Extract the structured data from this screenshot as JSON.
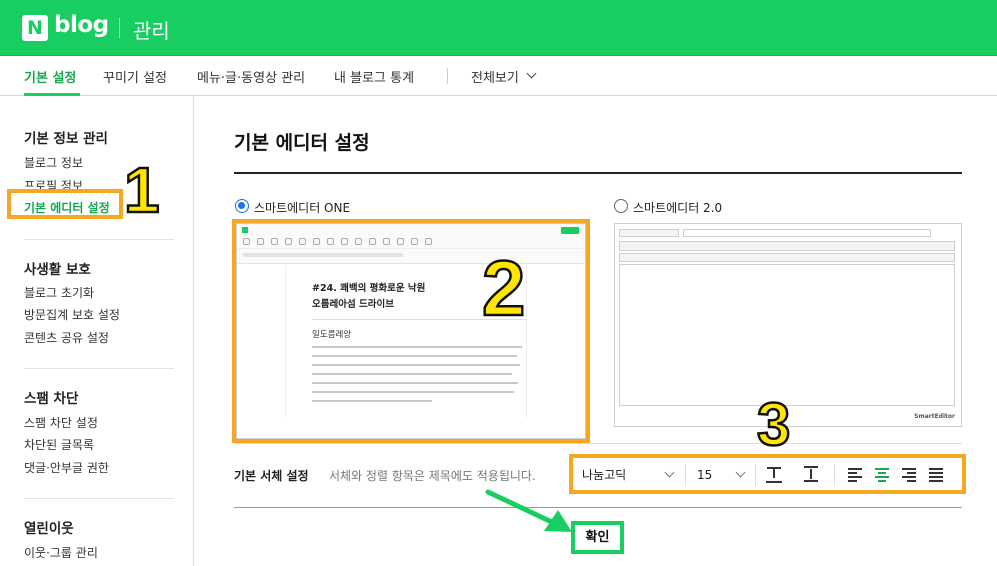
{
  "header": {
    "logo_letter": "N",
    "logo_text": "blog",
    "admin_label": "관리",
    "accent_color": "#19ce60"
  },
  "tabs": [
    {
      "label": "기본 설정",
      "active": true
    },
    {
      "label": "꾸미기 설정",
      "active": false
    },
    {
      "label": "메뉴·글·동영상 관리",
      "active": false
    },
    {
      "label": "내 블로그 통계",
      "active": false
    },
    {
      "label": "전체보기",
      "active": false
    }
  ],
  "sidebar": {
    "sections": [
      {
        "title": "기본 정보 관리",
        "items": [
          "블로그 정보",
          "프로필 정보",
          "기본 에디터 설정"
        ]
      },
      {
        "title": "사생활 보호",
        "items": [
          "블로그 초기화",
          "방문집계 보호 설정",
          "콘텐츠 공유 설정"
        ]
      },
      {
        "title": "스팸 차단",
        "items": [
          "스팸 차단 설정",
          "차단된 글목록",
          "댓글·안부글 권한"
        ]
      },
      {
        "title": "열린이웃",
        "items": [
          "이웃·그룹 관리"
        ]
      }
    ],
    "active_item": "기본 에디터 설정"
  },
  "main": {
    "title": "기본 에디터 설정",
    "editor_one_label": "스마트에디터 ONE",
    "editor_two_label": "스마트에디터 2.0",
    "selected_editor": "스마트에디터 ONE",
    "preview_one": {
      "title_line1": "#24. 쾌백의 평화로운 낙원",
      "title_line2": "오름레아섬 드라이브",
      "subtitle": "일도름레앙"
    },
    "preview_two": {
      "footer_logo": "SmartEditor"
    },
    "font_setting_label": "기본 서체 설정",
    "font_setting_desc": "서체와 정렬 항목은 제목에도 적용됩니다.",
    "font_family_value": "나눔고딕",
    "font_size_value": "15",
    "confirm_label": "확인"
  },
  "annotations": {
    "num1": "1",
    "num2": "2",
    "num3": "3",
    "box_color": "#f5a623",
    "number_color": "#ffe600",
    "arrow_color": "#19ce60"
  }
}
